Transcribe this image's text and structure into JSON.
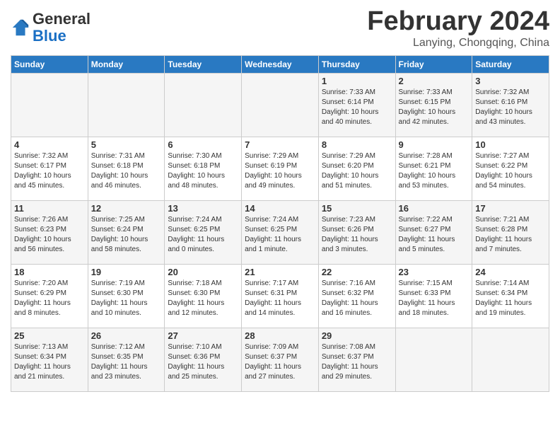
{
  "header": {
    "logo_general": "General",
    "logo_blue": "Blue",
    "month_title": "February 2024",
    "location": "Lanying, Chongqing, China"
  },
  "weekdays": [
    "Sunday",
    "Monday",
    "Tuesday",
    "Wednesday",
    "Thursday",
    "Friday",
    "Saturday"
  ],
  "weeks": [
    [
      {
        "day": "",
        "info": ""
      },
      {
        "day": "",
        "info": ""
      },
      {
        "day": "",
        "info": ""
      },
      {
        "day": "",
        "info": ""
      },
      {
        "day": "1",
        "info": "Sunrise: 7:33 AM\nSunset: 6:14 PM\nDaylight: 10 hours\nand 40 minutes."
      },
      {
        "day": "2",
        "info": "Sunrise: 7:33 AM\nSunset: 6:15 PM\nDaylight: 10 hours\nand 42 minutes."
      },
      {
        "day": "3",
        "info": "Sunrise: 7:32 AM\nSunset: 6:16 PM\nDaylight: 10 hours\nand 43 minutes."
      }
    ],
    [
      {
        "day": "4",
        "info": "Sunrise: 7:32 AM\nSunset: 6:17 PM\nDaylight: 10 hours\nand 45 minutes."
      },
      {
        "day": "5",
        "info": "Sunrise: 7:31 AM\nSunset: 6:18 PM\nDaylight: 10 hours\nand 46 minutes."
      },
      {
        "day": "6",
        "info": "Sunrise: 7:30 AM\nSunset: 6:18 PM\nDaylight: 10 hours\nand 48 minutes."
      },
      {
        "day": "7",
        "info": "Sunrise: 7:29 AM\nSunset: 6:19 PM\nDaylight: 10 hours\nand 49 minutes."
      },
      {
        "day": "8",
        "info": "Sunrise: 7:29 AM\nSunset: 6:20 PM\nDaylight: 10 hours\nand 51 minutes."
      },
      {
        "day": "9",
        "info": "Sunrise: 7:28 AM\nSunset: 6:21 PM\nDaylight: 10 hours\nand 53 minutes."
      },
      {
        "day": "10",
        "info": "Sunrise: 7:27 AM\nSunset: 6:22 PM\nDaylight: 10 hours\nand 54 minutes."
      }
    ],
    [
      {
        "day": "11",
        "info": "Sunrise: 7:26 AM\nSunset: 6:23 PM\nDaylight: 10 hours\nand 56 minutes."
      },
      {
        "day": "12",
        "info": "Sunrise: 7:25 AM\nSunset: 6:24 PM\nDaylight: 10 hours\nand 58 minutes."
      },
      {
        "day": "13",
        "info": "Sunrise: 7:24 AM\nSunset: 6:25 PM\nDaylight: 11 hours\nand 0 minutes."
      },
      {
        "day": "14",
        "info": "Sunrise: 7:24 AM\nSunset: 6:25 PM\nDaylight: 11 hours\nand 1 minute."
      },
      {
        "day": "15",
        "info": "Sunrise: 7:23 AM\nSunset: 6:26 PM\nDaylight: 11 hours\nand 3 minutes."
      },
      {
        "day": "16",
        "info": "Sunrise: 7:22 AM\nSunset: 6:27 PM\nDaylight: 11 hours\nand 5 minutes."
      },
      {
        "day": "17",
        "info": "Sunrise: 7:21 AM\nSunset: 6:28 PM\nDaylight: 11 hours\nand 7 minutes."
      }
    ],
    [
      {
        "day": "18",
        "info": "Sunrise: 7:20 AM\nSunset: 6:29 PM\nDaylight: 11 hours\nand 8 minutes."
      },
      {
        "day": "19",
        "info": "Sunrise: 7:19 AM\nSunset: 6:30 PM\nDaylight: 11 hours\nand 10 minutes."
      },
      {
        "day": "20",
        "info": "Sunrise: 7:18 AM\nSunset: 6:30 PM\nDaylight: 11 hours\nand 12 minutes."
      },
      {
        "day": "21",
        "info": "Sunrise: 7:17 AM\nSunset: 6:31 PM\nDaylight: 11 hours\nand 14 minutes."
      },
      {
        "day": "22",
        "info": "Sunrise: 7:16 AM\nSunset: 6:32 PM\nDaylight: 11 hours\nand 16 minutes."
      },
      {
        "day": "23",
        "info": "Sunrise: 7:15 AM\nSunset: 6:33 PM\nDaylight: 11 hours\nand 18 minutes."
      },
      {
        "day": "24",
        "info": "Sunrise: 7:14 AM\nSunset: 6:34 PM\nDaylight: 11 hours\nand 19 minutes."
      }
    ],
    [
      {
        "day": "25",
        "info": "Sunrise: 7:13 AM\nSunset: 6:34 PM\nDaylight: 11 hours\nand 21 minutes."
      },
      {
        "day": "26",
        "info": "Sunrise: 7:12 AM\nSunset: 6:35 PM\nDaylight: 11 hours\nand 23 minutes."
      },
      {
        "day": "27",
        "info": "Sunrise: 7:10 AM\nSunset: 6:36 PM\nDaylight: 11 hours\nand 25 minutes."
      },
      {
        "day": "28",
        "info": "Sunrise: 7:09 AM\nSunset: 6:37 PM\nDaylight: 11 hours\nand 27 minutes."
      },
      {
        "day": "29",
        "info": "Sunrise: 7:08 AM\nSunset: 6:37 PM\nDaylight: 11 hours\nand 29 minutes."
      },
      {
        "day": "",
        "info": ""
      },
      {
        "day": "",
        "info": ""
      }
    ]
  ]
}
